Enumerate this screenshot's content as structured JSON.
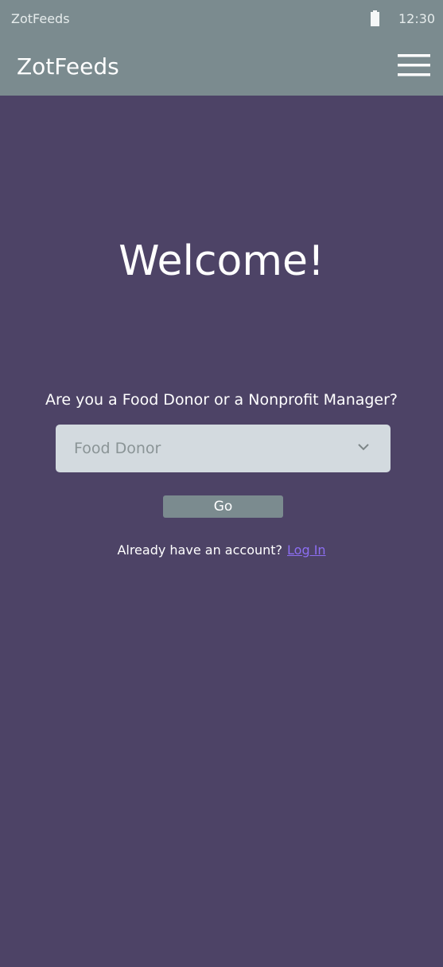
{
  "status_bar": {
    "app_name": "ZotFeeds",
    "time": "12:30",
    "battery_icon": "battery-full-icon"
  },
  "app_bar": {
    "title": "ZotFeeds",
    "menu_icon": "hamburger-menu-icon"
  },
  "main": {
    "heading": "Welcome!",
    "question": "Are you a Food Donor or a Nonprofit Manager?",
    "role_select": {
      "selected_value": "Food Donor",
      "icon": "chevron-down-icon"
    },
    "go_button_label": "Go",
    "account_prompt": "Already have an account?",
    "login_link": "Log In"
  },
  "colors": {
    "background": "#4d4366",
    "app_bar": "#7b8b8f",
    "select_background": "#d3dadf",
    "link": "#8c6ef2"
  }
}
